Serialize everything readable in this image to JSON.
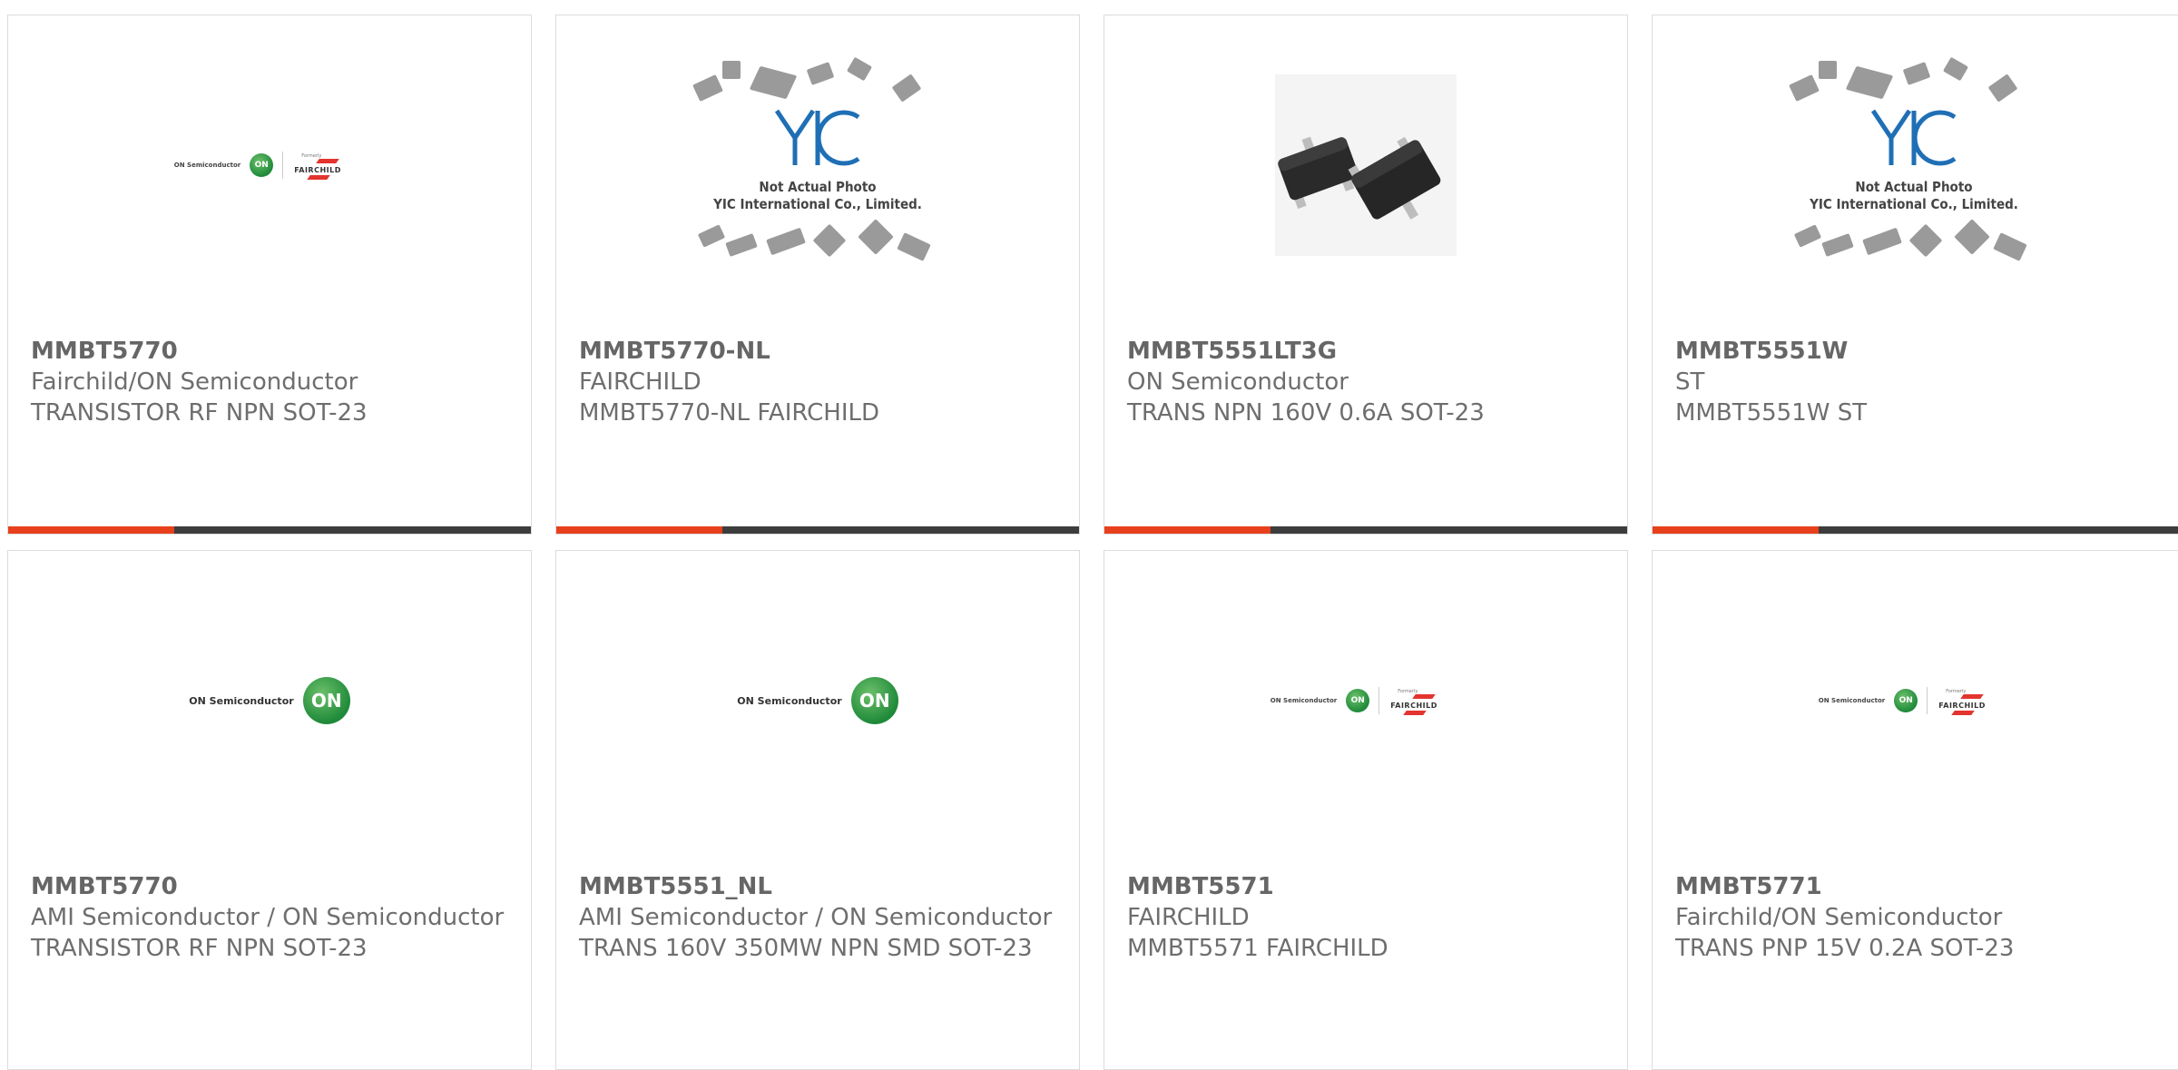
{
  "products": [
    {
      "part_number": "MMBT5770",
      "manufacturer": "Fairchild/ON Semiconductor",
      "description": "TRANSISTOR RF NPN SOT-23",
      "image": "on-fairchild-logo"
    },
    {
      "part_number": "MMBT5770-NL",
      "manufacturer": "FAIRCHILD",
      "description": "MMBT5770-NL FAIRCHILD",
      "image": "yic-placeholder"
    },
    {
      "part_number": "MMBT5551LT3G",
      "manufacturer": "ON Semiconductor",
      "description": "TRANS NPN 160V 0.6A SOT-23",
      "image": "sot23-photo"
    },
    {
      "part_number": "MMBT5551W",
      "manufacturer": "ST",
      "description": "MMBT5551W ST",
      "image": "yic-placeholder"
    },
    {
      "part_number": "MMBT5770",
      "manufacturer": "AMI Semiconductor / ON Semiconductor",
      "description": "TRANSISTOR RF NPN SOT-23",
      "image": "on-semiconductor-logo"
    },
    {
      "part_number": "MMBT5551_NL",
      "manufacturer": "AMI Semiconductor / ON Semiconductor",
      "description": "TRANS 160V 350MW NPN SMD SOT-23",
      "image": "on-semiconductor-logo"
    },
    {
      "part_number": "MMBT5571",
      "manufacturer": "FAIRCHILD",
      "description": "MMBT5571 FAIRCHILD",
      "image": "on-fairchild-logo"
    },
    {
      "part_number": "MMBT5771",
      "manufacturer": "Fairchild/ON Semiconductor",
      "description": "TRANS PNP 15V 0.2A SOT-23",
      "image": "on-fairchild-logo"
    }
  ],
  "logos": {
    "on_semiconductor_text": "ON Semiconductor",
    "on_circle_text": "ON",
    "fairchild_word": "FAIRCHILD",
    "fairchild_formerly": "Formerly",
    "yic_mark": "YIC",
    "yic_line1": "Not Actual Photo",
    "yic_line2": "YIC International Co., Limited."
  },
  "colors": {
    "accent": "#e8401c",
    "bar": "#3d3d3d",
    "text": "#6a6a6a",
    "on_green": "#1f8a3a",
    "fairchild_red": "#e3342f",
    "yic_blue": "#1f6fb5"
  }
}
